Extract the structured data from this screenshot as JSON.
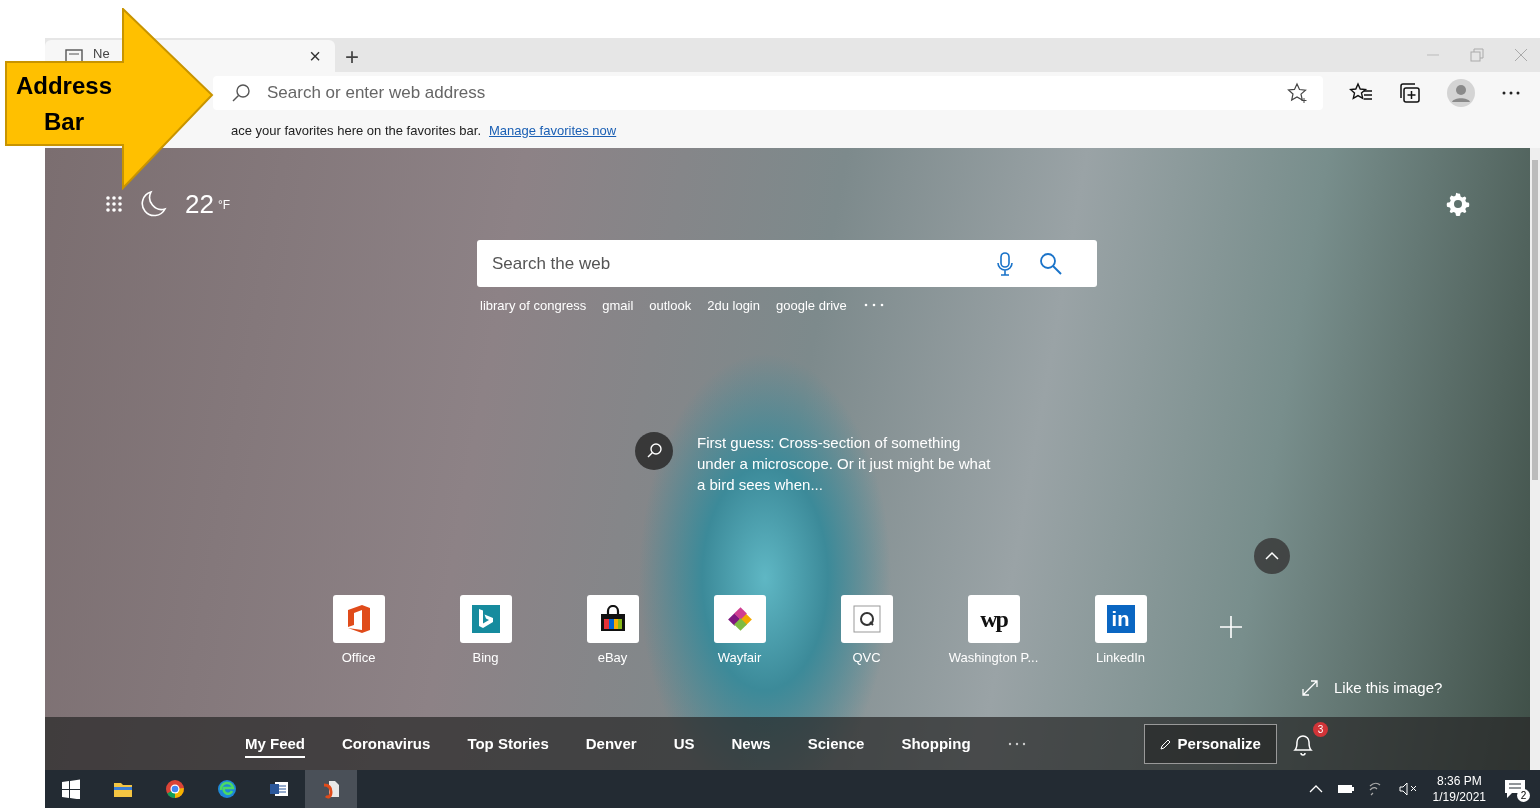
{
  "callout": {
    "text": "Address Bar"
  },
  "browser": {
    "tab": {
      "title": "Ne",
      "close": "×"
    },
    "new_tab": "+",
    "address_bar": {
      "placeholder": "Search or enter web address"
    },
    "favorites_bar": {
      "message": "ace your favorites here on the favorites bar.",
      "link": "Manage favorites now"
    }
  },
  "new_tab_page": {
    "weather": {
      "temperature": "22",
      "unit": "°F"
    },
    "search": {
      "placeholder": "Search the web"
    },
    "quick_searches": [
      "library of congress",
      "gmail",
      "outlook",
      "2du login",
      "google drive"
    ],
    "image_caption": "First guess: Cross-section of something under a microscope. Or it just might be what a bird sees when...",
    "top_sites": [
      {
        "label": "Office",
        "kind": "office"
      },
      {
        "label": "Bing",
        "kind": "bing"
      },
      {
        "label": "eBay",
        "kind": "bag"
      },
      {
        "label": "Wayfair",
        "kind": "flower"
      },
      {
        "label": "QVC",
        "kind": "qvc"
      },
      {
        "label": "Washington P...",
        "kind": "glyph",
        "glyph": "wp"
      },
      {
        "label": "LinkedIn",
        "kind": "tile",
        "glyph": "in"
      }
    ],
    "like_image": "Like this image?",
    "feed_tabs": [
      {
        "label": "My Feed",
        "selected": true
      },
      {
        "label": "Coronavirus",
        "selected": false
      },
      {
        "label": "Top Stories",
        "selected": false
      },
      {
        "label": "Denver",
        "selected": false
      },
      {
        "label": "US",
        "selected": false
      },
      {
        "label": "News",
        "selected": false
      },
      {
        "label": "Science",
        "selected": false
      },
      {
        "label": "Shopping",
        "selected": false
      }
    ],
    "personalize": "Personalize",
    "notification_count": "3"
  },
  "taskbar": {
    "time": "8:36 PM",
    "date": "1/19/2021",
    "notification_count": "2"
  }
}
